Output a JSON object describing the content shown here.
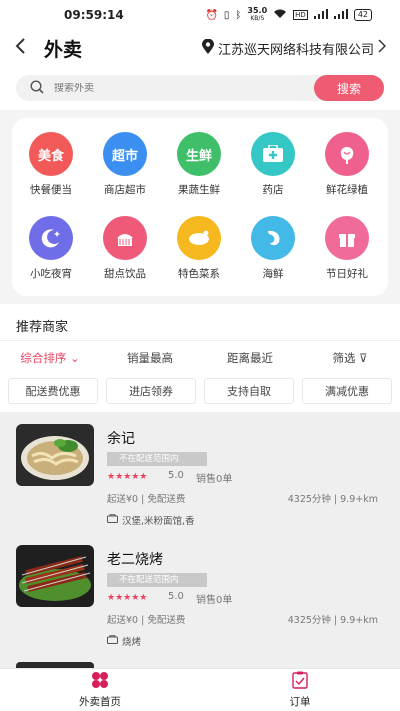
{
  "status": {
    "time": "09:59:14",
    "speed": "35.0",
    "speed_unit": "KB/S",
    "battery": "42"
  },
  "header": {
    "back_icon": "chevron-left-icon",
    "title": "外卖",
    "location": "江苏巡天网络科技有限公司"
  },
  "search": {
    "placeholder": "搜索外卖",
    "button": "搜索"
  },
  "categories": [
    {
      "label": "快餐便当",
      "icon_text": "美食",
      "color": "#f25a5a"
    },
    {
      "label": "商店超市",
      "icon_text": "超市",
      "color": "#3b8ff0"
    },
    {
      "label": "果蔬生鲜",
      "icon_text": "生鲜",
      "color": "#3fbf6a"
    },
    {
      "label": "药店",
      "icon_text": "",
      "color": "#35c6c6"
    },
    {
      "label": "鲜花绿植",
      "icon_text": "",
      "color": "#f0608c"
    },
    {
      "label": "小吃夜宵",
      "icon_text": "",
      "color": "#6f6ee8"
    },
    {
      "label": "甜点饮品",
      "icon_text": "",
      "color": "#ee5a78"
    },
    {
      "label": "特色菜系",
      "icon_text": "",
      "color": "#f5b81f"
    },
    {
      "label": "海鲜",
      "icon_text": "",
      "color": "#42b9e6"
    },
    {
      "label": "节日好礼",
      "icon_text": "",
      "color": "#f06a9a"
    }
  ],
  "recommend": {
    "title": "推荐商家",
    "sorts": [
      "综合排序",
      "销量最高",
      "距离最近",
      "筛选"
    ],
    "filters": [
      "配送费优惠",
      "进店领券",
      "支持自取",
      "满减优惠"
    ]
  },
  "shops": [
    {
      "name": "余记",
      "badge": "不在配送范围内",
      "stars": "★★★★★",
      "score": "5.0",
      "sales": "销售0单",
      "fee": "起送¥0 | 免配送费",
      "distance": "4325分钟 | 9.9+km",
      "tags": "汉堡,米粉面馆,香"
    },
    {
      "name": "老二烧烤",
      "badge": "不在配送范围内",
      "stars": "★★★★★",
      "score": "5.0",
      "sales": "销售0单",
      "fee": "起送¥0 | 免配送费",
      "distance": "4325分钟 | 9.9+km",
      "tags": "烧烤"
    }
  ],
  "tabbar": [
    {
      "label": "外卖首页"
    },
    {
      "label": "订单"
    }
  ],
  "colors": {
    "accent": "#e8445e",
    "button": "#ef5b70"
  }
}
